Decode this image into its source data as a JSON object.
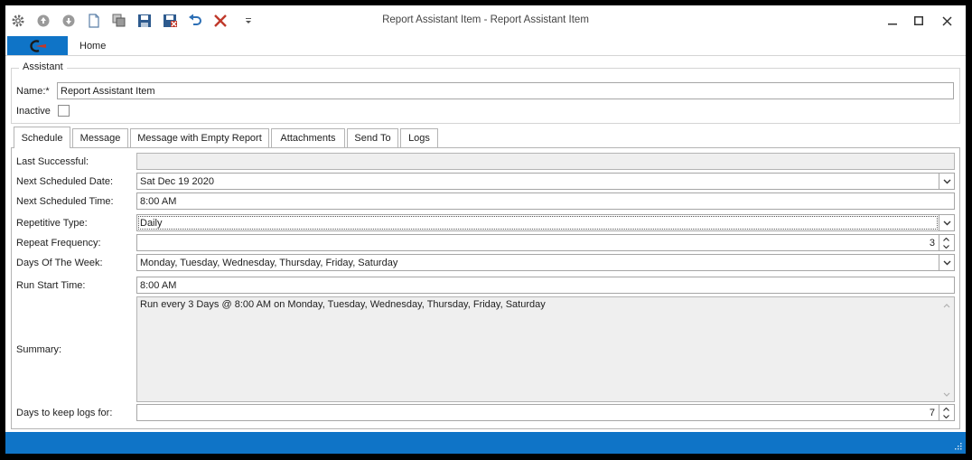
{
  "window": {
    "title": "Report Assistant Item - Report Assistant Item",
    "quick_access": [
      "gear-icon",
      "arrow-up-icon",
      "arrow-down-icon",
      "new-document-icon",
      "copy-icon",
      "save-icon",
      "save-and-close-icon",
      "undo-icon",
      "delete-icon",
      "customize-dropdown-icon"
    ],
    "controls": [
      "minimize",
      "maximize",
      "close"
    ]
  },
  "ribbon": {
    "home_tab": "Home"
  },
  "assistant": {
    "legend": "Assistant",
    "name_label": "Name:",
    "required_marker": "*",
    "name_value": "Report Assistant Item",
    "inactive_label": "Inactive",
    "inactive_checked": false
  },
  "tabs": [
    "Schedule",
    "Message",
    "Message with Empty Report",
    "Attachments",
    "Send To",
    "Logs"
  ],
  "active_tab": "Schedule",
  "schedule": {
    "last_successful_label": "Last Successful:",
    "last_successful_value": "",
    "next_date_label": "Next Scheduled Date:",
    "next_date_value": "Sat Dec 19 2020",
    "next_time_label": "Next Scheduled Time:",
    "next_time_value": "8:00 AM",
    "repetitive_type_label": "Repetitive Type:",
    "repetitive_type_value": "Daily",
    "repeat_frequency_label": "Repeat Frequency:",
    "repeat_frequency_value": "3",
    "days_of_week_label": "Days Of The Week:",
    "days_of_week_value": "Monday, Tuesday, Wednesday, Thursday, Friday, Saturday",
    "run_start_label": "Run Start Time:",
    "run_start_value": "8:00 AM",
    "summary_label": "Summary:",
    "summary_value": "Run every 3 Days @ 8:00 AM on Monday, Tuesday, Wednesday, Thursday, Friday, Saturday",
    "days_keep_logs_label": "Days to keep logs for:",
    "days_keep_logs_value": "7"
  },
  "colors": {
    "accent": "#0f74c7",
    "delete": "#c0392b"
  }
}
